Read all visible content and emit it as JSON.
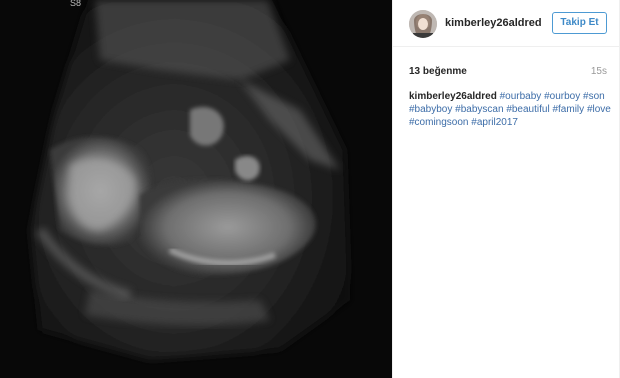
{
  "photo": {
    "overlay_text": "S8"
  },
  "header": {
    "username": "kimberley26aldred",
    "follow_label": "Takip Et"
  },
  "meta": {
    "likes": "13 beğenme",
    "time": "15s"
  },
  "caption": {
    "username": "kimberley26aldred",
    "hashtags": [
      "#ourbaby",
      "#ourboy",
      "#son",
      "#babyboy",
      "#babyscan",
      "#beautiful",
      "#family",
      "#love",
      "#comingsoon",
      "#april2017"
    ]
  },
  "colors": {
    "link": "#3d6da8",
    "follow_border": "#4d9ad3",
    "muted": "#999999"
  }
}
